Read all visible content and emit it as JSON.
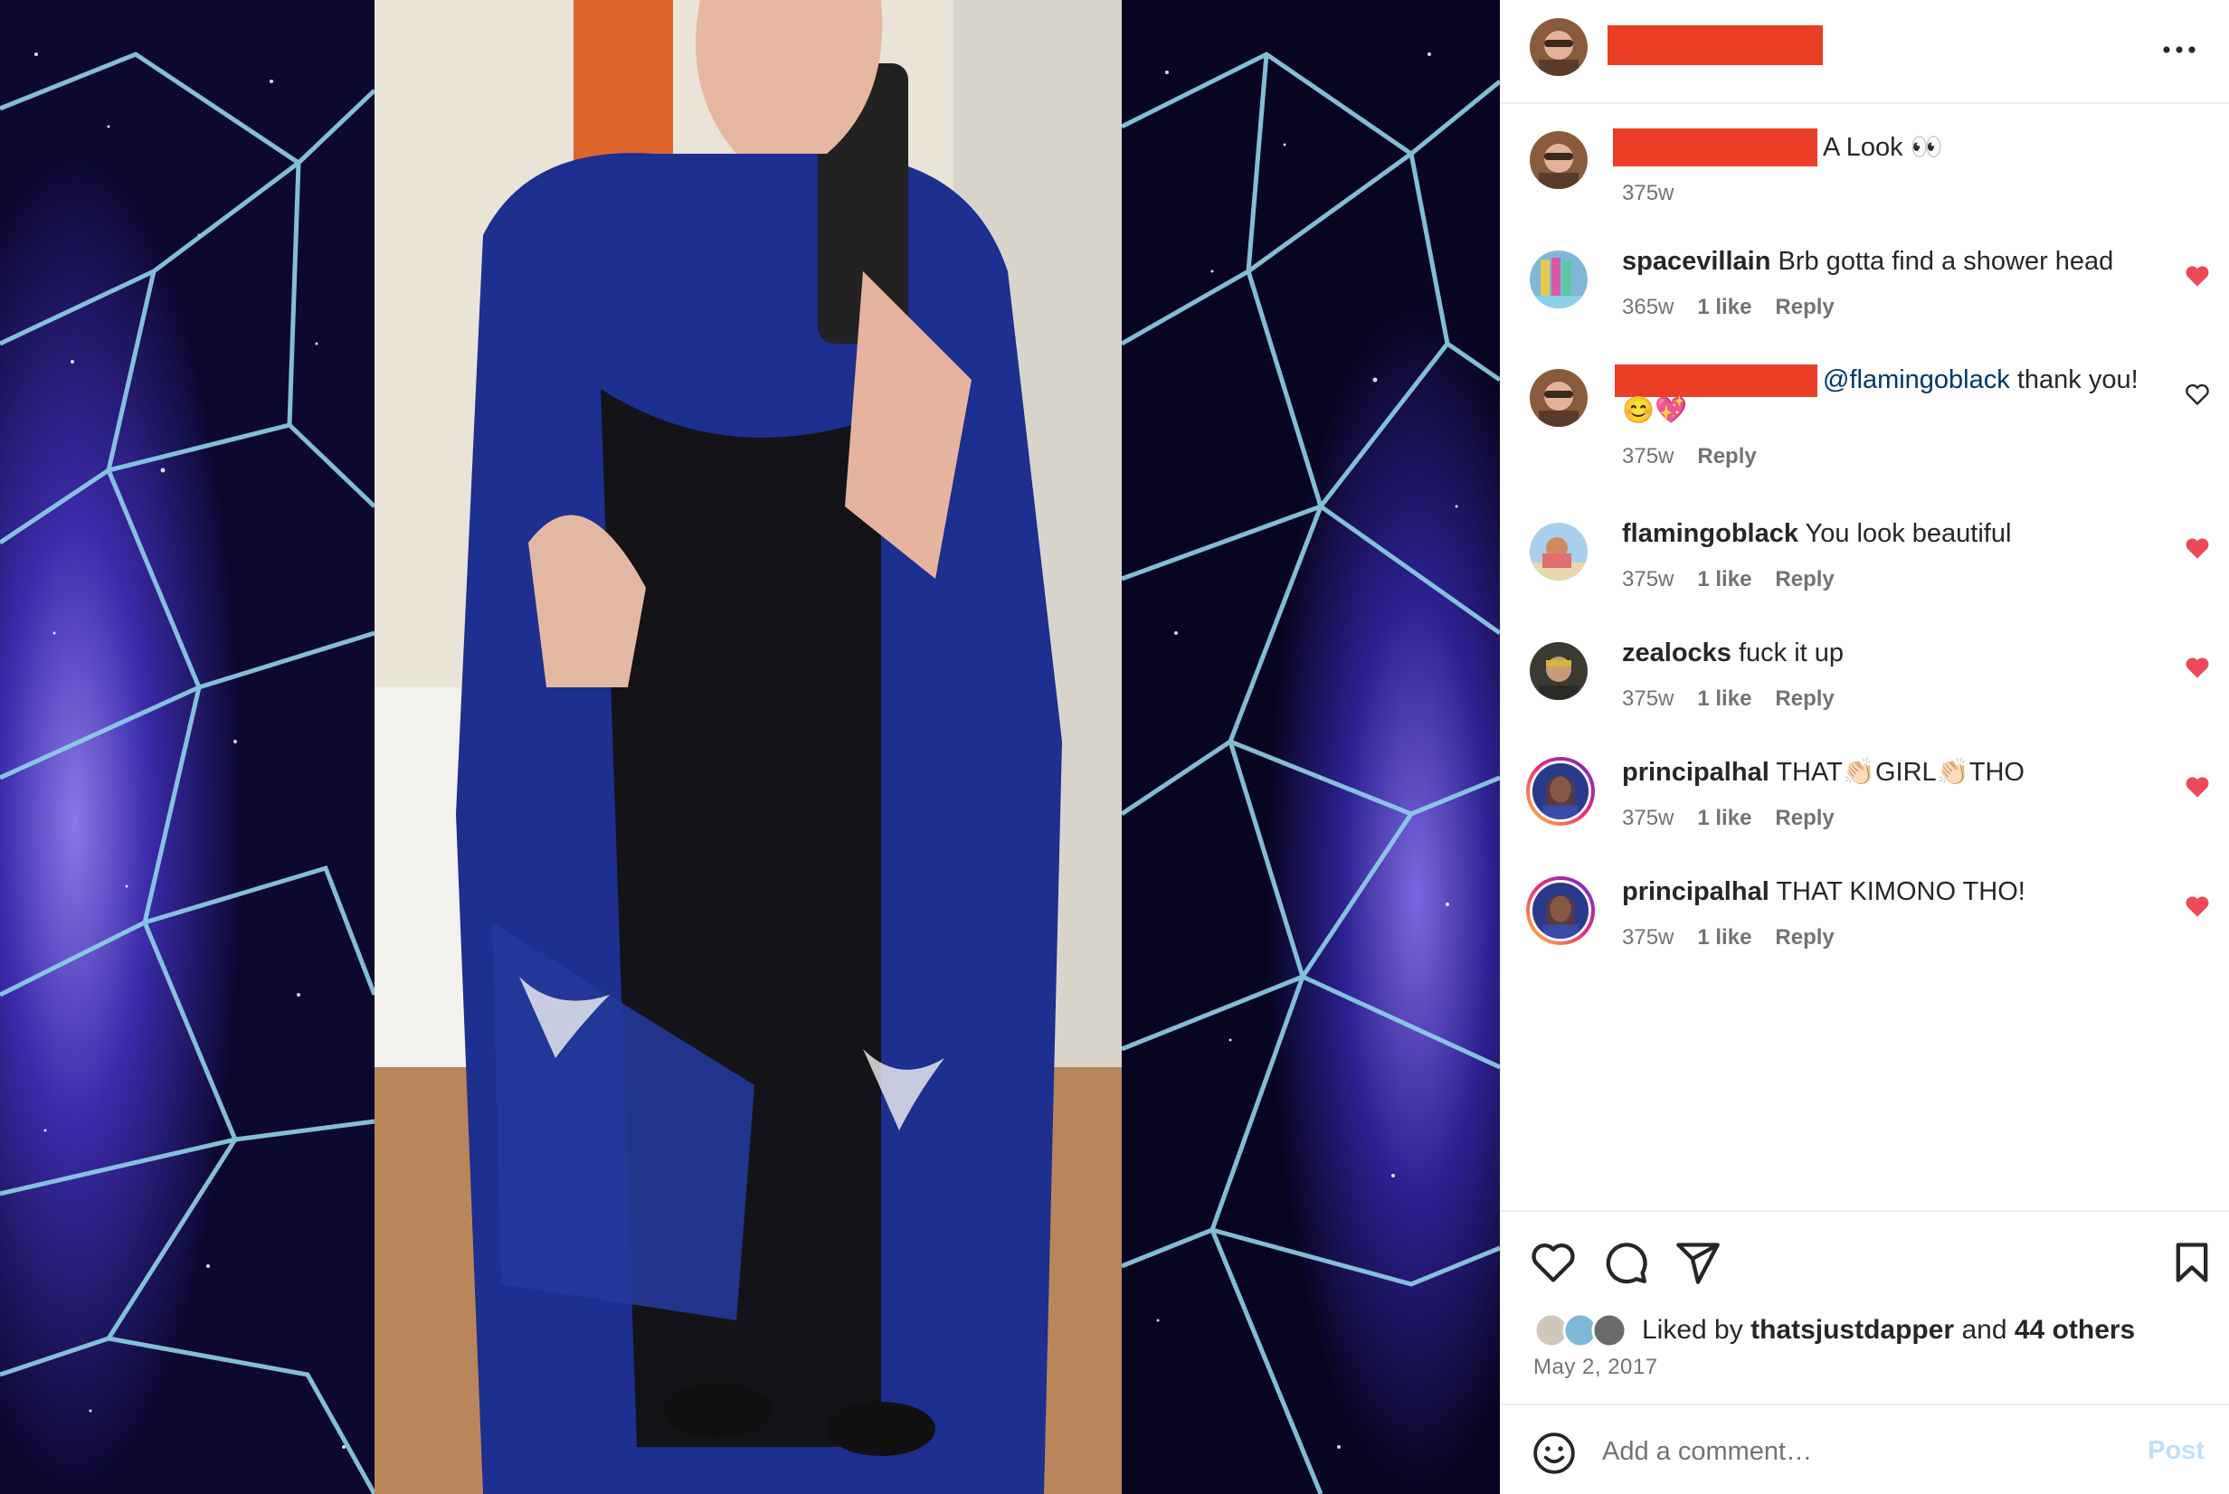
{
  "post": {
    "caption_text": "A Look 👀",
    "caption_time": "375w"
  },
  "comments": [
    {
      "user": "spacevillain",
      "text": "Brb gotta find a shower head",
      "time": "365w",
      "likes": "1 like",
      "reply": "Reply",
      "liked": true
    },
    {
      "user": "",
      "mention": "@flamingoblack",
      "text": " thank you! 😊💖",
      "time": "375w",
      "likes": "",
      "reply": "Reply",
      "liked": false
    },
    {
      "user": "flamingoblack",
      "text": "You look beautiful",
      "time": "375w",
      "likes": "1 like",
      "reply": "Reply",
      "liked": true
    },
    {
      "user": "zealocks",
      "text": "fuck it up",
      "time": "375w",
      "likes": "1 like",
      "reply": "Reply",
      "liked": true
    },
    {
      "user": "principalhal",
      "text": "THAT👏🏻GIRL👏🏻THO",
      "time": "375w",
      "likes": "1 like",
      "reply": "Reply",
      "liked": true
    },
    {
      "user": "principalhal",
      "text": "THAT KIMONO THO!",
      "time": "375w",
      "likes": "1 like",
      "reply": "Reply",
      "liked": true
    }
  ],
  "likes": {
    "prefix": "Liked by ",
    "user": "thatsjustdapper",
    "middle": " and ",
    "others": "44 others"
  },
  "date": "May 2, 2017",
  "add_comment": {
    "placeholder": "Add a comment…",
    "post_label": "Post"
  },
  "colors": {
    "redaction": "#ea3f26",
    "like_red": "#ed4956",
    "mention": "#00376b",
    "post_disabled": "#c0dffd"
  },
  "icons": {
    "header_more": "more-horizontal-icon",
    "like": "heart-icon",
    "comment": "comment-bubble-icon",
    "share": "paper-plane-icon",
    "save": "bookmark-icon",
    "emoji": "smiley-icon"
  }
}
